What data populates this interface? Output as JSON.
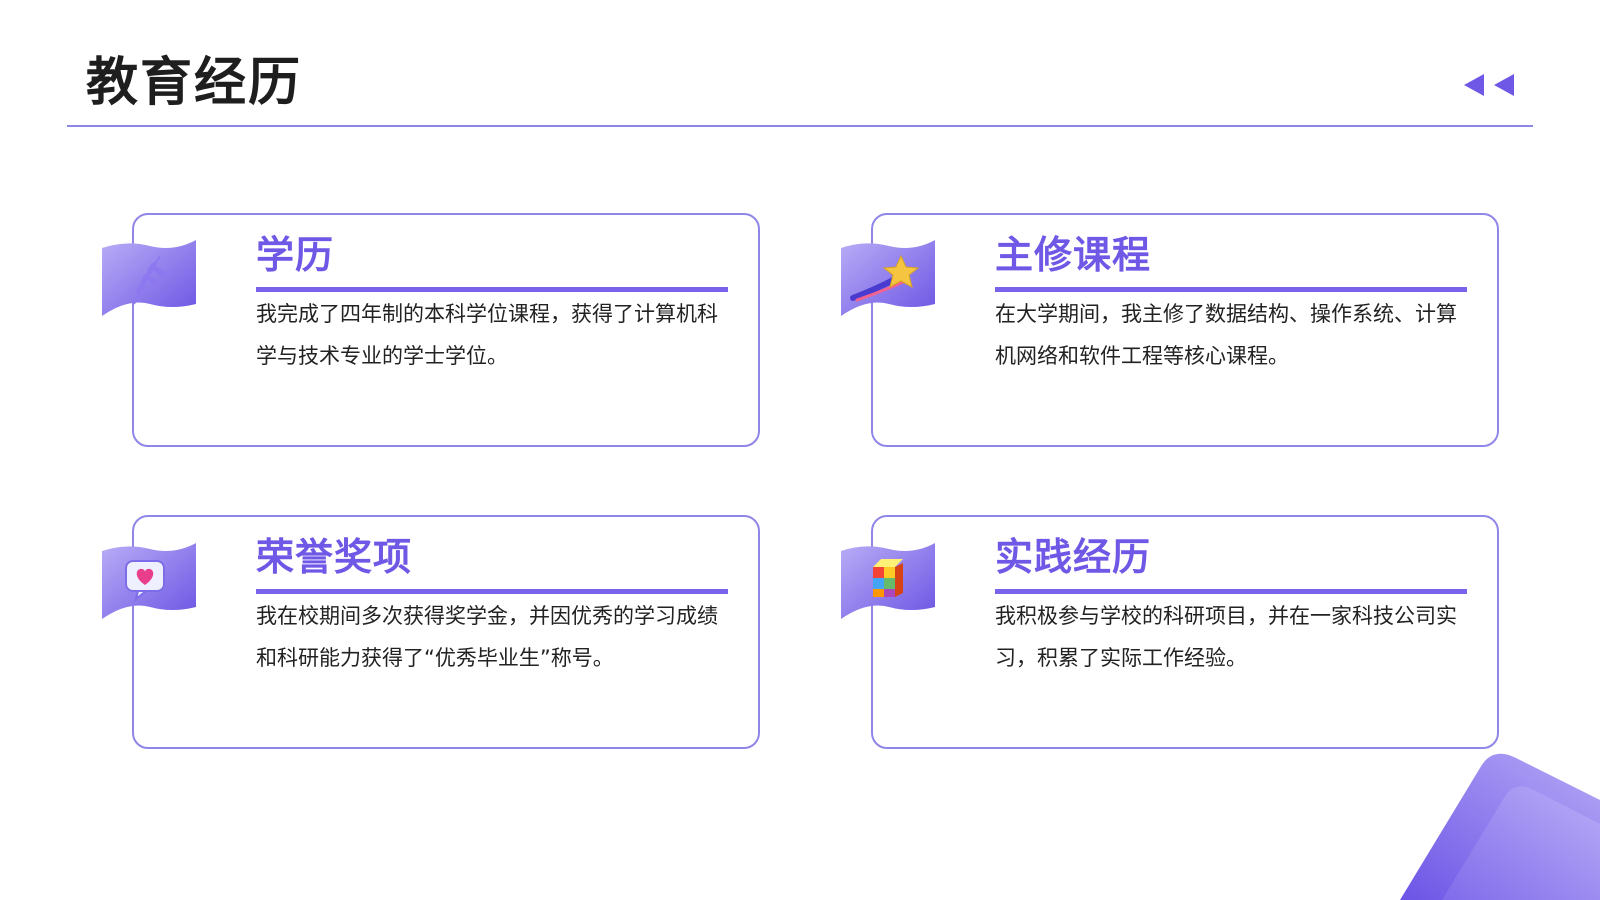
{
  "page": {
    "title": "教育经历"
  },
  "colors": {
    "accent": "#6f58e6",
    "border": "#8f86e8",
    "rule": "#8d85e6",
    "flag_light": "#b3a6f5",
    "flag_dark": "#6f58e6"
  },
  "nav": {
    "icon": "double-left-arrow-icon"
  },
  "cards": [
    {
      "title": "学历",
      "body": "我完成了四年制的本科学位课程，获得了计算机科学与技术专业的学士学位。",
      "icon": "wheat-icon"
    },
    {
      "title": "主修课程",
      "body": "在大学期间，我主修了数据结构、操作系统、计算机网络和软件工程等核心课程。",
      "icon": "shooting-star-icon"
    },
    {
      "title": "荣誉奖项",
      "body": "我在校期间多次获得奖学金，并因优秀的学习成绩和科研能力获得了“优秀毕业生”称号。",
      "icon": "heart-message-icon"
    },
    {
      "title": "实践经历",
      "body": "我积极参与学校的科研项目，并在一家科技公司实习，积累了实际工作经验。",
      "icon": "cube-icon"
    }
  ]
}
